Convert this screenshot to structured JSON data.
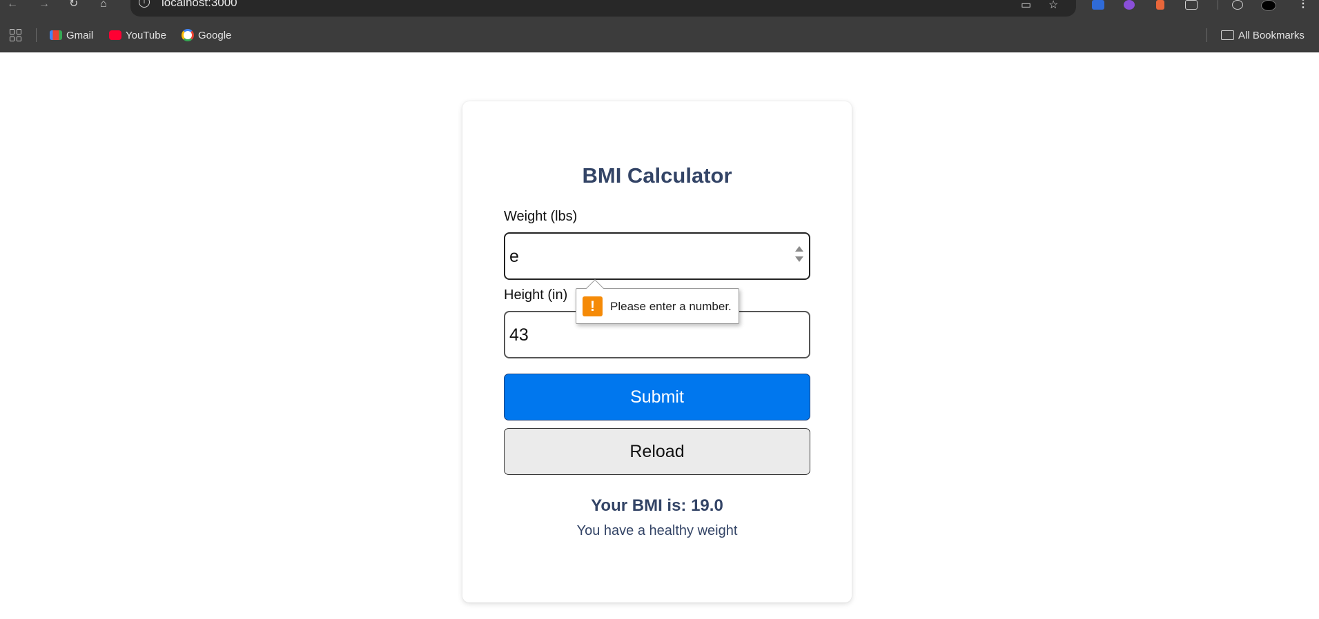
{
  "browser": {
    "url": "localhost:3000",
    "bookmarks": [
      {
        "label": "Gmail",
        "icon": "gmail-icon"
      },
      {
        "label": "YouTube",
        "icon": "youtube-icon"
      },
      {
        "label": "Google",
        "icon": "google-icon"
      }
    ],
    "all_bookmarks_label": "All Bookmarks"
  },
  "app": {
    "title": "BMI Calculator",
    "weight": {
      "label": "Weight (lbs)",
      "value": "e"
    },
    "height": {
      "label": "Height (in)",
      "value": "43"
    },
    "submit_label": "Submit",
    "reload_label": "Reload",
    "result_text": "Your BMI is: 19.0",
    "result_message": "You have a healthy weight",
    "validation_message": "Please enter a number."
  },
  "colors": {
    "accent": "#0077ee",
    "title": "#334466",
    "warning": "#f58a07"
  }
}
